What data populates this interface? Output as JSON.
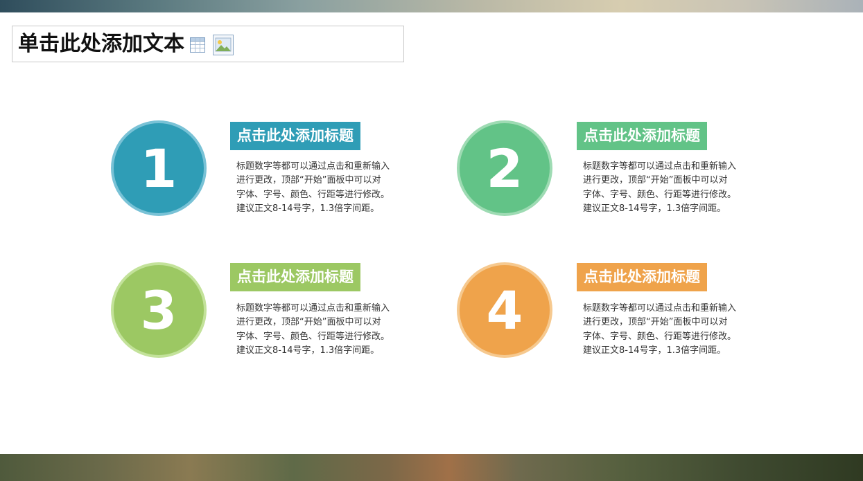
{
  "slide": {
    "title": "单击此处添加文本"
  },
  "icons": {
    "table": "table-icon",
    "picture": "picture-icon"
  },
  "items": [
    {
      "number": "1",
      "heading": "点击此处添加标题",
      "lines": [
        "标题数字等都可以通过点击和重新输入",
        "进行更改，顶部“开始”面板中可以对",
        "字体、字号、颜色、行距等进行修改。",
        "建议正文8-14号字，1.3倍字间距。"
      ],
      "color": "#2f9db6",
      "ring": "#79c2d6"
    },
    {
      "number": "2",
      "heading": "点击此处添加标题",
      "lines": [
        "标题数字等都可以通过点击和重新输入",
        "进行更改，顶部“开始”面板中可以对",
        "字体、字号、颜色、行距等进行修改。",
        "建议正文8-14号字，1.3倍字间距。"
      ],
      "color": "#62c387",
      "ring": "#9edbb3"
    },
    {
      "number": "3",
      "heading": "点击此处添加标题",
      "lines": [
        "标题数字等都可以通过点击和重新输入",
        "进行更改，顶部“开始”面板中可以对",
        "字体、字号、颜色、行距等进行修改。",
        "建议正文8-14号字，1.3倍字间距。"
      ],
      "color": "#9cc863",
      "ring": "#c3e29a"
    },
    {
      "number": "4",
      "heading": "点击此处添加标题",
      "lines": [
        "标题数字等都可以通过点击和重新输入",
        "进行更改，顶部“开始”面板中可以对",
        "字体、字号、颜色、行距等进行修改。",
        "建议正文8-14号字，1.3倍字间距。"
      ],
      "color": "#efa34b",
      "ring": "#f6c98f"
    }
  ]
}
